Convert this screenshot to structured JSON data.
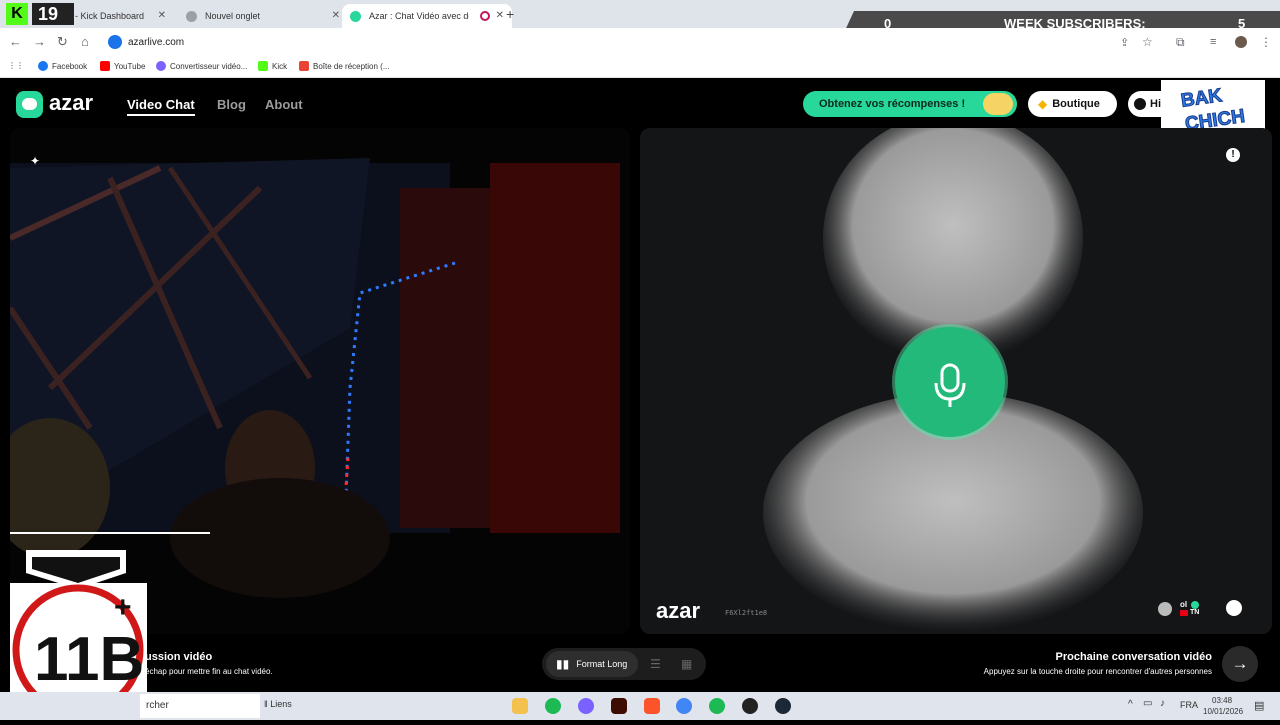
{
  "browser": {
    "tabs": [
      {
        "label": "- Kick Dashboard",
        "active": false
      },
      {
        "label": "Nouvel onglet",
        "active": false
      },
      {
        "label": "Azar : Chat Vidéo avec de n",
        "active": true
      }
    ],
    "new_tab_icon": "plus-icon",
    "url": "azarlive.com",
    "bookmarks": [
      "Facebook",
      "YouTube",
      "Convertisseur vidéo...",
      "Kick",
      "Boîte de réception (..."
    ]
  },
  "stream_overlay": {
    "kick_count": "19",
    "week_label": "WEEK SUBSCRIBERS:",
    "left_count": "0",
    "right_count": "5",
    "badge_line1": "BAK",
    "badge_line2": "CHICH",
    "logo_text": "11B"
  },
  "azar": {
    "logo": "azar",
    "nav": [
      {
        "label": "Video Chat",
        "active": true
      },
      {
        "label": "Blog",
        "active": false
      },
      {
        "label": "About",
        "active": false
      }
    ],
    "rewards_label": "Obtenez vos récompenses !",
    "shop_label": "Boutique",
    "history_label": "Hi",
    "watermark_logo": "azar",
    "watermark_code": "F6Xl2ft1e8",
    "partner_name": "ol",
    "partner_country": "TN",
    "end_title": "ussion vidéo",
    "end_hint": "échap pour mettre fin au chat vidéo.",
    "format_label": "Format Long",
    "next_title": "Prochaine conversation vidéo",
    "next_hint": "Appuyez sur la touche droite pour rencontrer d'autres personnes"
  },
  "taskbar": {
    "search_text": "rcher",
    "links_label": "Liens",
    "lang": "FRA",
    "time": "03:48",
    "date": "10/01/2026"
  },
  "colors": {
    "azar_green": "#27d89a",
    "mic_green": "#22b97a",
    "chrome_tab_bar": "#dfe3ea",
    "overlay_gray": "#4a4a4a"
  }
}
